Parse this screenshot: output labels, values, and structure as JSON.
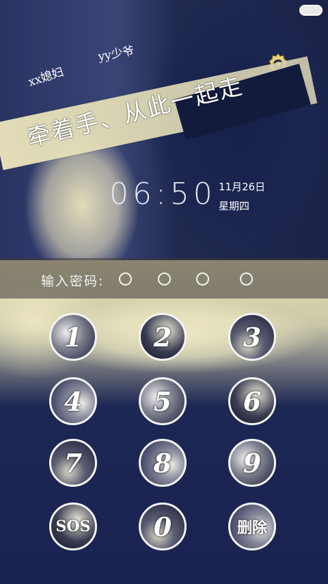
{
  "tags": {
    "left": "xx媳妇",
    "right": "yy少爷"
  },
  "slogan": "牵着手、从此一起走",
  "clock": {
    "time": "06:50",
    "date": "11月26日",
    "weekday": "星期四"
  },
  "password": {
    "label": "输入密码:",
    "dots_count": 4
  },
  "keypad": {
    "k1": "1",
    "k2": "2",
    "k3": "3",
    "k4": "4",
    "k5": "5",
    "k6": "6",
    "k7": "7",
    "k8": "8",
    "k9": "9",
    "sos": "SOS",
    "k0": "0",
    "delete": "删除"
  },
  "icons": {
    "settings": "gear-icon",
    "status": "battery-pill-icon"
  }
}
